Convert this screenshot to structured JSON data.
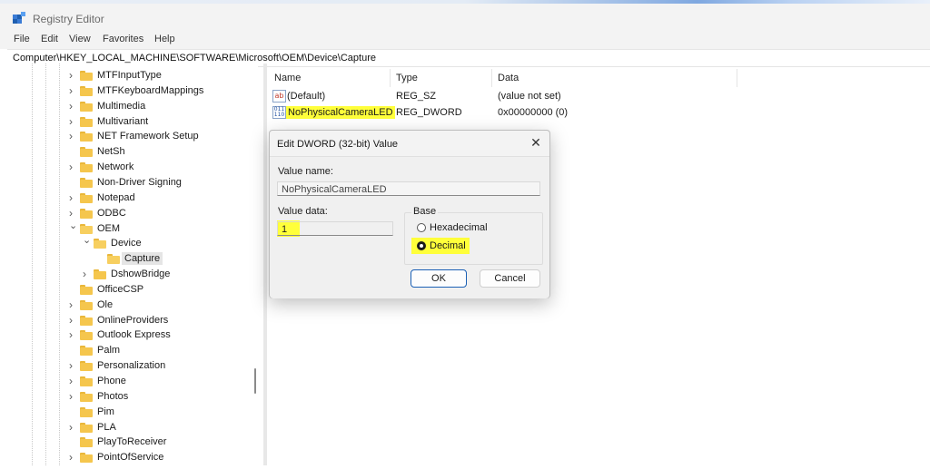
{
  "window": {
    "title": "Registry Editor"
  },
  "menu": [
    "File",
    "Edit",
    "View",
    "Favorites",
    "Help"
  ],
  "address": "Computer\\HKEY_LOCAL_MACHINE\\SOFTWARE\\Microsoft\\OEM\\Device\\Capture",
  "tree": [
    {
      "label": "MTFInputType",
      "state": "collapsed"
    },
    {
      "label": "MTFKeyboardMappings",
      "state": "collapsed"
    },
    {
      "label": "Multimedia",
      "state": "collapsed"
    },
    {
      "label": "Multivariant",
      "state": "collapsed"
    },
    {
      "label": "NET Framework Setup",
      "state": "collapsed"
    },
    {
      "label": "NetSh",
      "state": "leaf"
    },
    {
      "label": "Network",
      "state": "collapsed"
    },
    {
      "label": "Non-Driver Signing",
      "state": "leaf"
    },
    {
      "label": "Notepad",
      "state": "collapsed"
    },
    {
      "label": "ODBC",
      "state": "collapsed"
    },
    {
      "label": "OEM",
      "state": "expanded"
    },
    {
      "label": "Device",
      "state": "expanded"
    },
    {
      "label": "Capture",
      "state": "selected"
    },
    {
      "label": "DshowBridge",
      "state": "collapsed"
    },
    {
      "label": "OfficeCSP",
      "state": "leaf"
    },
    {
      "label": "Ole",
      "state": "collapsed"
    },
    {
      "label": "OnlineProviders",
      "state": "collapsed"
    },
    {
      "label": "Outlook Express",
      "state": "collapsed"
    },
    {
      "label": "Palm",
      "state": "leaf"
    },
    {
      "label": "Personalization",
      "state": "collapsed"
    },
    {
      "label": "Phone",
      "state": "collapsed"
    },
    {
      "label": "Photos",
      "state": "collapsed"
    },
    {
      "label": "Pim",
      "state": "leaf"
    },
    {
      "label": "PLA",
      "state": "collapsed"
    },
    {
      "label": "PlayToReceiver",
      "state": "leaf"
    },
    {
      "label": "PointOfService",
      "state": "collapsed"
    }
  ],
  "list": {
    "columns": {
      "name": "Name",
      "type": "Type",
      "data": "Data"
    },
    "rows": [
      {
        "icon": "string-value-icon",
        "name": "(Default)",
        "type": "REG_SZ",
        "data": "(value not set)"
      },
      {
        "icon": "dword-value-icon",
        "name": "NoPhysicalCameraLED",
        "type": "REG_DWORD",
        "data": "0x00000000 (0)",
        "highlighted": true
      }
    ]
  },
  "dialog": {
    "title": "Edit DWORD (32-bit) Value",
    "value_name_label": "Value name:",
    "value_name": "NoPhysicalCameraLED",
    "value_data_label": "Value data:",
    "value_data": "1",
    "base_label": "Base",
    "hex_label": "Hexadecimal",
    "dec_label": "Decimal",
    "selected_base": "Decimal",
    "ok_label": "OK",
    "cancel_label": "Cancel"
  },
  "colors": {
    "highlight": "#ffff3a",
    "folder": "#f5c64d",
    "default_button_border": "#1a5fb4"
  }
}
